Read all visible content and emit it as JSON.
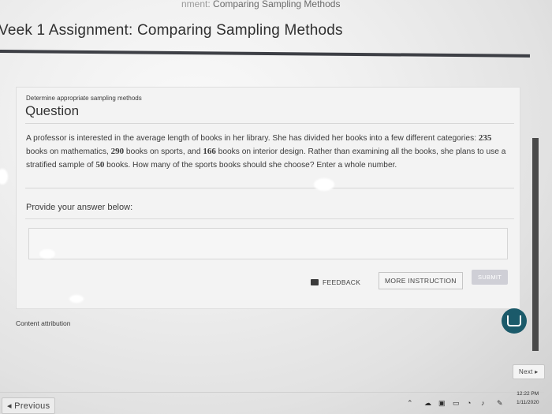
{
  "browser": {
    "tab_title": "Comparing Sampling Methods",
    "tab_title_prefix": "nment: "
  },
  "page": {
    "title": "Veek 1 Assignment: Comparing Sampling Methods"
  },
  "question_card": {
    "topic_label": "Determine appropriate sampling methods",
    "heading": "Question",
    "text_parts": [
      "A professor is interested in the average length of books in her library. She has divided her books into a few different categories: ",
      "235",
      " books on mathematics, ",
      "290",
      " books on sports, and ",
      "166",
      " books on interior design. Rather than examining all the books, she plans to use a stratified sample of ",
      "50",
      " books. How many of the sports books should she choose? Enter a whole number."
    ],
    "answer_prompt": "Provide your answer below:",
    "answer_value": "",
    "buttons": {
      "feedback": "FEEDBACK",
      "more_instruction": "MORE INSTRUCTION",
      "submit": "SUBMIT"
    }
  },
  "footer": {
    "content_attribution": "Content attribution",
    "next": "Next ▸",
    "previous": "◂ Previous"
  },
  "taskbar": {
    "time": "12:22 PM",
    "date": "1/11/2020"
  },
  "colors": {
    "title_rule": "#3d3f45",
    "chat_button": "#1b5a6a",
    "submit_disabled": "#cfcfd6"
  },
  "icons": [
    "feedback-icon",
    "chat-icon",
    "wifi-icon",
    "volume-icon",
    "chevron-up-icon"
  ]
}
